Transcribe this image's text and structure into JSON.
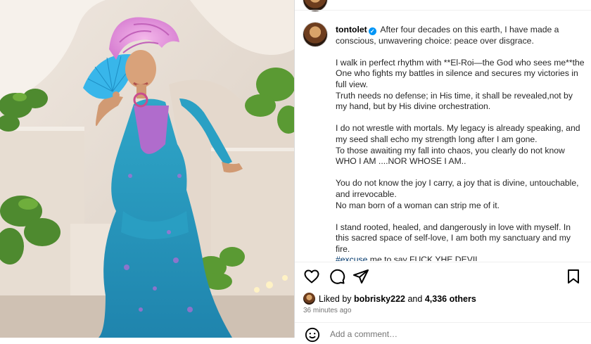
{
  "post": {
    "username": "tontolet",
    "verified_mark": "✓",
    "caption_lines": {
      "p1": "After four decades on this earth, I have made a conscious, unwavering choice: peace over disgrace.",
      "p2a": "I walk in perfect rhythm with **El-Roi—the God who sees me**the One who fights my battles in silence and secures my victories in full view.",
      "p2b": "Truth needs no defense; in His time, it shall be revealed,not by my hand, but by His divine orchestration.",
      "p3a": "I do not wrestle with mortals. My legacy is already speaking, and my seed shall echo my strength long after I am gone.",
      "p3b": "To those awaiting my fall into chaos, you clearly do not know WHO I AM ....NOR WHOSE I AM..",
      "p4a": "You do not know the joy I carry, a joy that is divine, untouchable, and irrevocable.",
      "p4b": "No man born of a woman can strip me of it.",
      "p5": "I stand rooted, healed, and dangerously in love with myself. In this sacred space of self-love, I am both my sanctuary and my fire.",
      "p6_hashtag": "#excuse",
      "p6_rest": " me to say FUCK YHE DEVIL"
    },
    "likes": {
      "prefix": "Liked by ",
      "user": "bobrisky222",
      "middle": " and ",
      "count": "4,336 others"
    },
    "time_ago": "36 minutes ago"
  },
  "comment_box": {
    "placeholder": "Add a comment…"
  },
  "icons": {
    "like": "heart-icon",
    "comment": "comment-icon",
    "share": "share-icon",
    "save": "bookmark-icon",
    "emoji": "emoji-icon"
  },
  "colors": {
    "verified": "#0095f6",
    "hashtag": "#00376b",
    "muted": "#737373",
    "border": "#dbdbdb"
  }
}
